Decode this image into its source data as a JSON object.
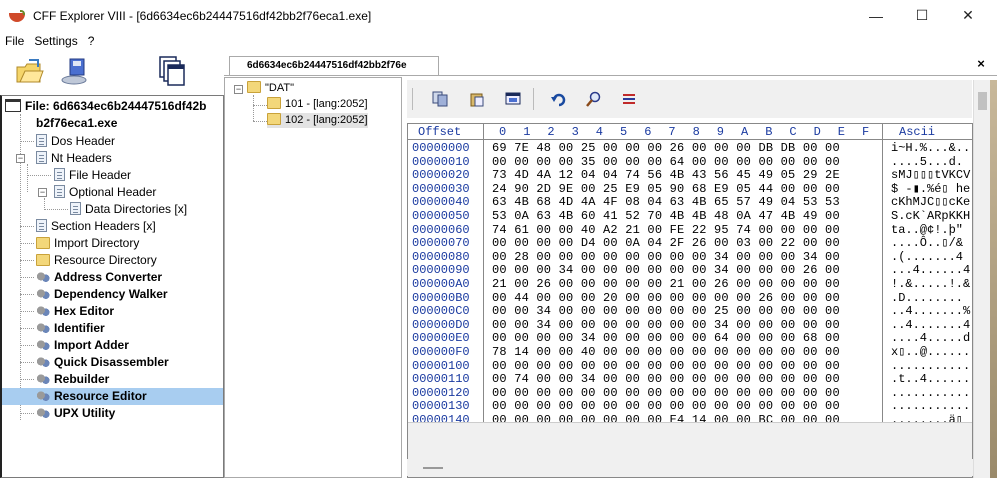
{
  "window": {
    "title": "CFF Explorer VIII - [6d6634ec6b24447516df42bb2f76eca1.exe]",
    "controls": {
      "minimize": "—",
      "maximize": "☐",
      "close": "✕"
    }
  },
  "menu": [
    "File",
    "Settings",
    "?"
  ],
  "tab": {
    "label": "6d6634ec6b24447516df42bb2f76e",
    "close": "×"
  },
  "left_tree": {
    "root_line1": "File: 6d6634ec6b24447516df42b",
    "root_line2": "b2f76eca1.exe",
    "items": [
      "Dos Header",
      "Nt Headers",
      "File Header",
      "Optional Header",
      "Data Directories [x]",
      "Section Headers [x]",
      "Import Directory",
      "Resource Directory",
      "Address Converter",
      "Dependency Walker",
      "Hex Editor",
      "Identifier",
      "Import Adder",
      "Quick Disassembler",
      "Rebuilder",
      "Resource Editor",
      "UPX Utility"
    ],
    "selected": "Resource Editor"
  },
  "resource_tree": {
    "root": "\"DAT\"",
    "children": [
      "101 - [lang:2052]",
      "102 - [lang:2052]"
    ],
    "selected": "102 - [lang:2052]"
  },
  "hex": {
    "header_offset": "Offset",
    "columns": [
      "0",
      "1",
      "2",
      "3",
      "4",
      "5",
      "6",
      "7",
      "8",
      "9",
      "A",
      "B",
      "C",
      "D",
      "E",
      "F"
    ],
    "header_ascii": "Ascii",
    "rows": [
      {
        "offset": "00000000",
        "bytes": "69 7E 48 00 25 00 00 00 26 00 00 00 DB DB 00 00",
        "ascii": "i~H.%...&..."
      },
      {
        "offset": "00000010",
        "bytes": "00 00 00 00 35 00 00 00 64 00 00 00 00 00 00 00",
        "ascii": "....5...d."
      },
      {
        "offset": "00000020",
        "bytes": "73 4D 4A 12 04 04 74 56 4B 43 56 45 49 05 29 2E",
        "ascii": "sMJ▯▯▯tVKCV"
      },
      {
        "offset": "00000030",
        "bytes": "24 90 2D 9E 00 25 E9 05 90 68 E9 05 44 00 00 00",
        "ascii": "$ -▮.%é▯ he"
      },
      {
        "offset": "00000040",
        "bytes": "63 4B 68 4D 4A 4F 08 04 63 4B 65 57 49 04 53 53",
        "ascii": "cKhMJC▯▯cKe"
      },
      {
        "offset": "00000050",
        "bytes": "53 0A 63 4B 60 41 52 70 4B 4B 48 0A 47 4B 49 00",
        "ascii": "S.cK`ARpKKH"
      },
      {
        "offset": "00000060",
        "bytes": "74 61 00 00 40 A2 21 00 FE 22 95 74 00 00 00 00",
        "ascii": "ta..@¢!.þ\""
      },
      {
        "offset": "00000070",
        "bytes": "00 00 00 00 D4 00 0A 04 2F 26 00 03 00 22 00 00",
        "ascii": "....Ô..▯/&"
      },
      {
        "offset": "00000080",
        "bytes": "00 28 00 00 00 00 00 00 00 00 34 00 00 00 34 00",
        "ascii": ".(.......4"
      },
      {
        "offset": "00000090",
        "bytes": "00 00 00 34 00 00 00 00 00 00 34 00 00 00 26 00",
        "ascii": "...4......4"
      },
      {
        "offset": "000000A0",
        "bytes": "21 00 26 00 00 00 00 00 21 00 26 00 00 00 00 00",
        "ascii": "!.&.....!.&"
      },
      {
        "offset": "000000B0",
        "bytes": "00 44 00 00 00 20 00 00 00 00 00 00 26 00 00 00",
        "ascii": ".D........"
      },
      {
        "offset": "000000C0",
        "bytes": "00 00 34 00 00 00 00 00 00 00 25 00 00 00 00 00",
        "ascii": "..4.......%"
      },
      {
        "offset": "000000D0",
        "bytes": "00 00 34 00 00 00 00 00 00 00 34 00 00 00 00 00",
        "ascii": "..4.......4"
      },
      {
        "offset": "000000E0",
        "bytes": "00 00 00 00 34 00 00 00 00 00 64 00 00 00 68 00",
        "ascii": "....4.....d"
      },
      {
        "offset": "000000F0",
        "bytes": "78 14 00 00 40 00 00 00 00 00 00 00 00 00 00 00",
        "ascii": "x▯..@......"
      },
      {
        "offset": "00000100",
        "bytes": "00 00 00 00 00 00 00 00 00 00 00 00 00 00 00 00",
        "ascii": "..........."
      },
      {
        "offset": "00000110",
        "bytes": "00 74 00 00 34 00 00 00 00 00 00 00 00 00 00 00",
        "ascii": ".t..4......"
      },
      {
        "offset": "00000120",
        "bytes": "00 00 00 00 00 00 00 00 00 00 00 00 00 00 00 00",
        "ascii": "..........."
      },
      {
        "offset": "00000130",
        "bytes": "00 00 00 00 00 00 00 00 00 00 00 00 00 00 00 00",
        "ascii": "..........."
      },
      {
        "offset": "00000140",
        "bytes": "00 00 00 00 00 00 00 00 E4 14 00 00 BC 00 00 00",
        "ascii": "........ä▯"
      }
    ]
  }
}
